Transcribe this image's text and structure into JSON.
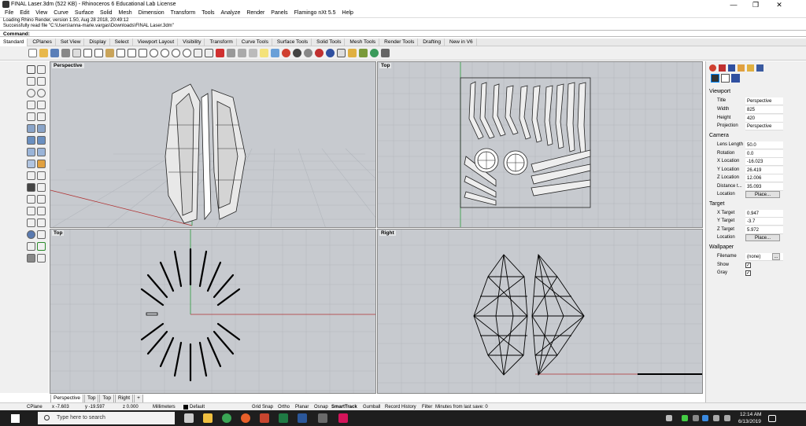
{
  "window": {
    "title": "FINAL Laser.3dm (522 KB) - Rhinoceros 6 Educational Lab License",
    "minimize": "—",
    "maximize": "❐",
    "close": "✕"
  },
  "menu": [
    "File",
    "Edit",
    "View",
    "Curve",
    "Surface",
    "Solid",
    "Mesh",
    "Dimension",
    "Transform",
    "Tools",
    "Analyze",
    "Render",
    "Panels",
    "Flamingo nXt 5.5",
    "Help"
  ],
  "history": [
    "Loading Rhino Render, version 1.50, Aug 28 2018, 20:49:12",
    "Successfully read file \"C:\\Users\\anna-marie.vargas\\Downloads\\FINAL Laser.3dm\""
  ],
  "command": {
    "label": "Command:"
  },
  "tabs": [
    "Standard",
    "CPlanes",
    "Set View",
    "Display",
    "Select",
    "Viewport Layout",
    "Visibility",
    "Transform",
    "Curve Tools",
    "Surface Tools",
    "Solid Tools",
    "Mesh Tools",
    "Render Tools",
    "Drafting",
    "New in V6"
  ],
  "viewports": {
    "perspective": "Perspective",
    "top": "Top",
    "bottom_left": "Top",
    "right": "Right"
  },
  "vptabs": [
    "Perspective",
    "Top",
    "Top",
    "Right",
    "+"
  ],
  "status": {
    "cplane": "CPlane",
    "x": "x -7.603",
    "y": "y -19.597",
    "z": "z 0.000",
    "units": "Millimeters",
    "layer": "Default",
    "grid_snap": "Grid Snap",
    "ortho": "Ortho",
    "planar": "Planar",
    "osnap": "Osnap",
    "smarttrack": "SmartTrack",
    "gumball": "Gumball",
    "record_history": "Record History",
    "filter": "Filter",
    "save_info": "Minutes from last save: 0"
  },
  "panel": {
    "viewport": {
      "heading": "Viewport",
      "title_k": "Title",
      "title_v": "Perspective",
      "width_k": "Width",
      "width_v": "825",
      "height_k": "Height",
      "height_v": "420",
      "projection_k": "Projection",
      "projection_v": "Perspective"
    },
    "camera": {
      "heading": "Camera",
      "lens_k": "Lens Length",
      "lens_v": "50.0",
      "rotation_k": "Rotation",
      "rotation_v": "0.0",
      "xloc_k": "X Location",
      "xloc_v": "-16.023",
      "yloc_k": "Y Location",
      "yloc_v": "26.419",
      "zloc_k": "Z Location",
      "zloc_v": "12.006",
      "dist_k": "Distance t...",
      "dist_v": "35.093",
      "location_k": "Location",
      "place_btn": "Place..."
    },
    "target": {
      "heading": "Target",
      "xt_k": "X Target",
      "xt_v": "0.947",
      "yt_k": "Y Target",
      "yt_v": "-3.7",
      "zt_k": "Z Target",
      "zt_v": "5.972",
      "location_k": "Location",
      "place_btn": "Place..."
    },
    "wallpaper": {
      "heading": "Wallpaper",
      "filename_k": "Filename",
      "filename_v": "(none)",
      "browse_btn": "...",
      "show_k": "Show",
      "gray_k": "Gray"
    }
  },
  "taskbar": {
    "search_placeholder": "Type here to search",
    "time": "12:14 AM",
    "date": "6/13/2019"
  },
  "colors": {
    "viewport_bg": "#c7cacf",
    "grid_line": "#b2b6bc",
    "x_axis": "#b03030",
    "y_axis": "#2a9a3a",
    "taskbar": "#1e1e1e"
  }
}
